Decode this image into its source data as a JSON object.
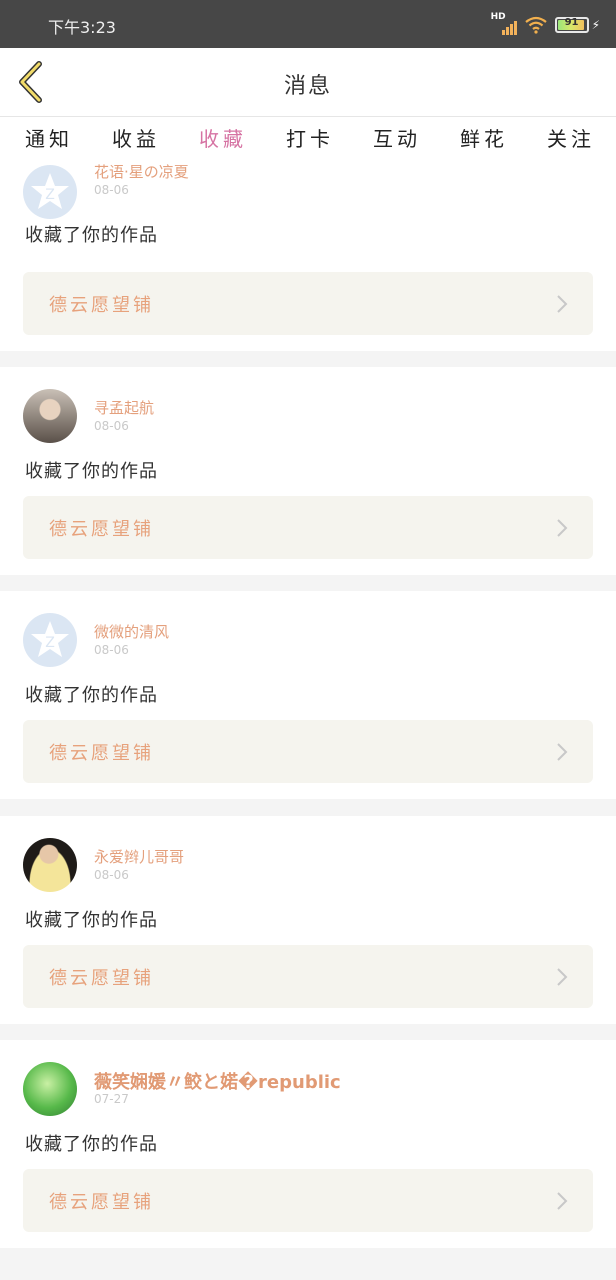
{
  "status_bar": {
    "time": "下午3:23",
    "network": "HD",
    "battery": "91"
  },
  "header": {
    "title": "消息"
  },
  "tabs": [
    {
      "label": "通知",
      "active": false
    },
    {
      "label": "收益",
      "active": false
    },
    {
      "label": "收藏",
      "active": true
    },
    {
      "label": "打卡",
      "active": false
    },
    {
      "label": "互动",
      "active": false
    },
    {
      "label": "鲜花",
      "active": false
    },
    {
      "label": "关注",
      "active": false
    }
  ],
  "colors": {
    "accent": "#d673a3",
    "name": "#e4a07d",
    "work_box_bg": "#f5f4ee"
  },
  "messages": [
    {
      "user": "花语·星の凉夏",
      "date": "08-06",
      "action": "收藏了你的作品",
      "work": "德云愿望铺",
      "avatar": "default-avatar"
    },
    {
      "user": "寻孟起航",
      "date": "08-06",
      "action": "收藏了你的作品",
      "work": "德云愿望铺",
      "avatar": "user-photo"
    },
    {
      "user": "微微的清风",
      "date": "08-06",
      "action": "收藏了你的作品",
      "work": "德云愿望铺",
      "avatar": "default-avatar"
    },
    {
      "user": "永爱辫儿哥哥",
      "date": "08-06",
      "action": "收藏了你的作品",
      "work": "德云愿望铺",
      "avatar": "user-photo"
    },
    {
      "user": "薇笑娴媛〃鲛と婼�republic",
      "date": "07-27",
      "action": "收藏了你的作品",
      "work": "德云愿望铺",
      "avatar": "user-photo"
    }
  ]
}
